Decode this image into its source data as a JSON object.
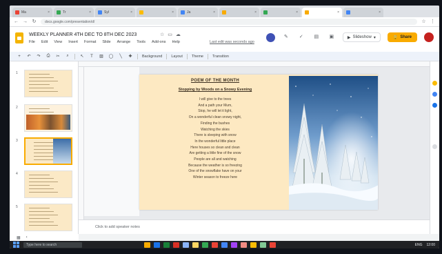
{
  "browser": {
    "tabs": [
      {
        "label": "Ma",
        "color": "#ea4335"
      },
      {
        "label": "Tr",
        "color": "#34a853"
      },
      {
        "label": "Syl",
        "color": "#4285f4"
      },
      {
        "label": "",
        "color": "#fbbc04"
      },
      {
        "label": "Ja",
        "color": "#4285f4"
      },
      {
        "label": "",
        "color": "#f9ab00"
      },
      {
        "label": "",
        "color": "#34a853"
      },
      {
        "label": "",
        "color": "#f9ab00",
        "active": true
      },
      {
        "label": "",
        "color": "#4285f4"
      }
    ],
    "url": "docs.google.com/presentation/d/"
  },
  "doc": {
    "title": "WEEKLY PLANNER 4TH DEC TO 8TH DEC 2023",
    "menu": [
      "File",
      "Edit",
      "View",
      "Insert",
      "Format",
      "Slide",
      "Arrange",
      "Tools",
      "Add-ons",
      "Help"
    ],
    "last_edit": "Last edit was seconds ago",
    "slideshow_label": "Slideshow",
    "share_label": "Share",
    "share_icon": "lock-icon"
  },
  "toolbar": {
    "background_label": "Background",
    "layout_label": "Layout",
    "theme_label": "Theme",
    "transition_label": "Transition"
  },
  "filmstrip": {
    "slides": [
      {
        "num": "1",
        "selected": false
      },
      {
        "num": "2",
        "selected": false
      },
      {
        "num": "3",
        "selected": true
      },
      {
        "num": "4",
        "selected": false
      },
      {
        "num": "5",
        "selected": false
      }
    ]
  },
  "slide": {
    "title": "POEM OF THE MONTH",
    "subtitle": "Stopping by Woods on a Snowy Evening",
    "poem_lines": [
      "I will give to the trees",
      "And a path your Mum,",
      "Stop, he will let it light,",
      "On a wonderful clean snowy night,",
      "Finding the bushes",
      "Watching the skies",
      "There is sleeping with snow",
      "In the wonderful little place",
      "Here houses so clean and clean",
      "Are getting a little fine of the snow",
      "People are all and watching",
      "Because the weather is so freezing",
      "One of the snowflake have on your",
      "Winter season to freeze here"
    ],
    "image": "snowy-forest-image"
  },
  "notes": {
    "placeholder": "Click to add speaker notes"
  },
  "taskbar": {
    "search_placeholder": "Type here to search",
    "apps": [
      "#f9ab00",
      "#1a73e8",
      "#188038",
      "#d93025",
      "#8ab4f8",
      "#fdd663",
      "#34a853",
      "#ea4335",
      "#4285f4",
      "#a142f4",
      "#f28b82",
      "#fbbc04",
      "#81c995",
      "#ea4335"
    ],
    "tray_left": "ENG",
    "tray_time": "12:00"
  }
}
